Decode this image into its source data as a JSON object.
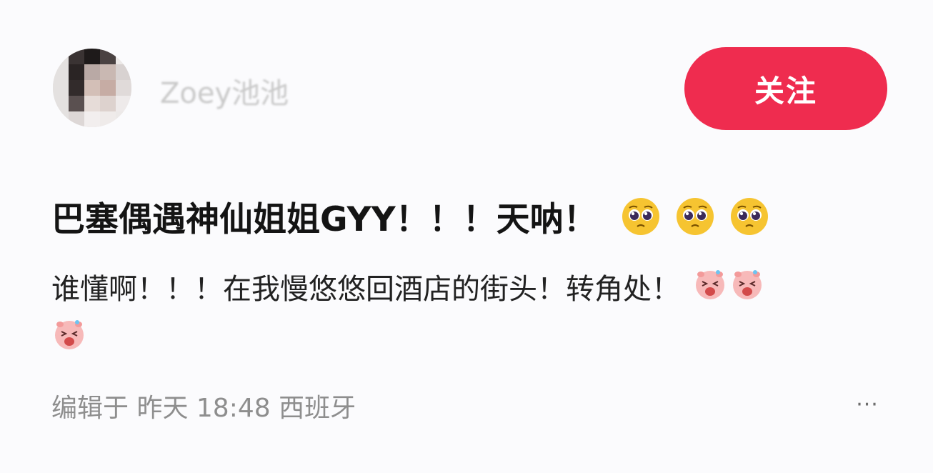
{
  "header": {
    "username": "Zoey池池",
    "follow_label": "关注"
  },
  "post": {
    "title": "巴塞偶遇神仙姐姐GYY！！！天呐！",
    "title_emojis": [
      "pleading-face",
      "pleading-face",
      "pleading-face"
    ],
    "body": "谁懂啊！！！在我慢悠悠回酒店的街头！转角处！",
    "body_emojis": [
      "shocked-pig",
      "shocked-pig",
      "shocked-pig"
    ]
  },
  "footer": {
    "meta": "编辑于 昨天 18:48 西班牙",
    "more_label": "···"
  },
  "colors": {
    "accent": "#ef2c4f",
    "meta_text": "#8e8e8e",
    "emoji_face": "#f6c431"
  }
}
